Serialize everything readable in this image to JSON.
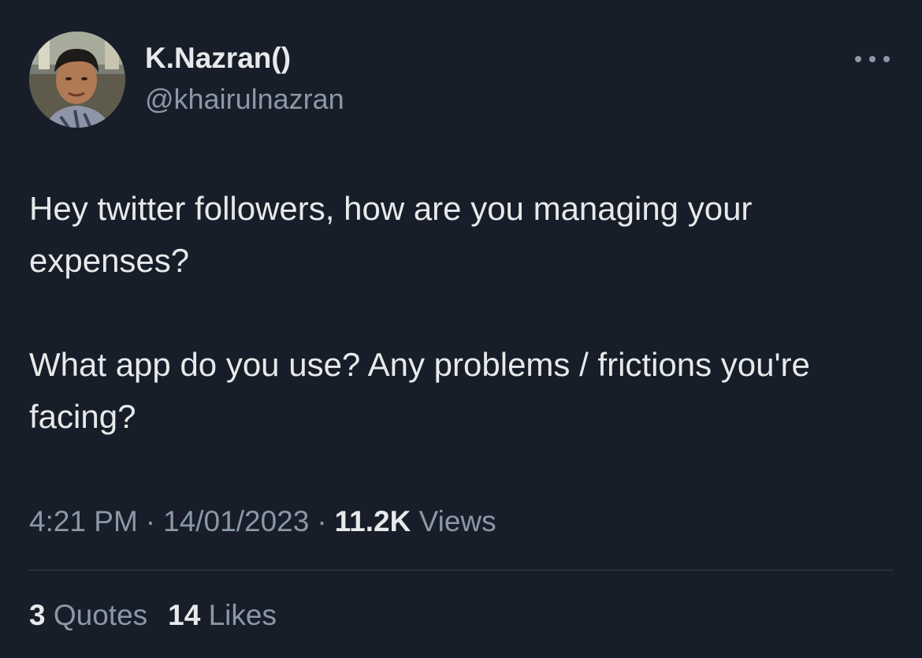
{
  "author": {
    "display_name": "K.Nazran()",
    "handle": "@khairulnazran"
  },
  "tweet": {
    "paragraphs": [
      "Hey twitter followers, how are you managing your expenses?",
      "What app do you use? Any problems / frictions you're facing?"
    ],
    "time": "4:21 PM",
    "date": "14/01/2023",
    "views_count": "11.2K",
    "views_label": "Views",
    "separator": "·"
  },
  "stats": {
    "quotes_count": "3",
    "quotes_label": "Quotes",
    "likes_count": "14",
    "likes_label": "Likes"
  },
  "icons": {
    "more": "more-options-icon"
  },
  "colors": {
    "background": "#171e29",
    "primary_text": "#e7e9ea",
    "secondary_text": "#8b98a5",
    "divider": "#333d49"
  }
}
